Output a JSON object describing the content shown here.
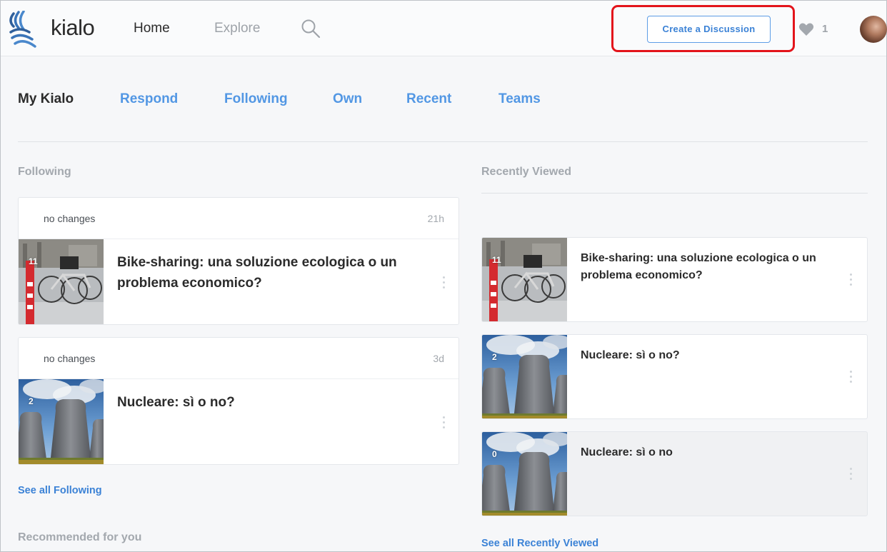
{
  "header": {
    "brand": "kialo",
    "nav_home": "Home",
    "nav_explore": "Explore",
    "create_button": "Create a Discussion",
    "heart_count": "1",
    "accent_color": "#3b82d6",
    "highlight_color": "#e3141b"
  },
  "tabs": [
    {
      "label": "My Kialo",
      "active": true
    },
    {
      "label": "Respond",
      "active": false
    },
    {
      "label": "Following",
      "active": false
    },
    {
      "label": "Own",
      "active": false
    },
    {
      "label": "Recent",
      "active": false
    },
    {
      "label": "Teams",
      "active": false
    }
  ],
  "following": {
    "title": "Following",
    "items": [
      {
        "status": "no changes",
        "time": "21h",
        "title": "Bike-sharing: una soluzione ecologica o un problema economico?",
        "badge": "11",
        "image": "bikes-image"
      },
      {
        "status": "no changes",
        "time": "3d",
        "title": "Nucleare: sì o no?",
        "badge": "2",
        "image": "cooling-towers-image"
      }
    ],
    "see_all": "See all Following"
  },
  "recently_viewed": {
    "title": "Recently Viewed",
    "items": [
      {
        "title": "Bike-sharing: una soluzione ecologica o un problema economico?",
        "badge": "11",
        "image": "bikes-image"
      },
      {
        "title": "Nucleare: sì o no?",
        "badge": "2",
        "image": "cooling-towers-image"
      },
      {
        "title": "Nucleare: sì o no",
        "badge": "0",
        "image": "cooling-towers-image"
      }
    ],
    "see_all": "See all Recently Viewed"
  },
  "recommended": {
    "title": "Recommended for you"
  }
}
